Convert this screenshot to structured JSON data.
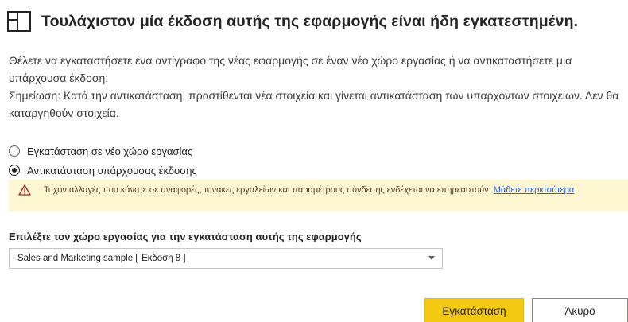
{
  "dialog": {
    "title": "Τουλάχιστον μία έκδοση αυτής της εφαρμογής είναι ήδη εγκατεστημένη.",
    "icon": "app-layout-icon",
    "description_line1": "Θέλετε να εγκαταστήσετε ένα αντίγραφο της νέας εφαρμογής σε έναν νέο χώρο εργασίας ή να αντικαταστήσετε μια υπάρχουσα έκδοση;",
    "description_line2": "Σημείωση: Κατά την αντικατάσταση, προστίθενται νέα στοιχεία και γίνεται αντικατάσταση των υπαρχόντων στοιχείων. Δεν θα καταργηθούν στοιχεία."
  },
  "options": {
    "items": [
      {
        "label": "Εγκατάσταση σε νέο χώρο εργασίας",
        "selected": false
      },
      {
        "label": "Αντικατάσταση υπάρχουσας έκδοσης",
        "selected": true
      }
    ]
  },
  "warning": {
    "icon": "warning-icon",
    "text": "Τυχόν αλλαγές που κάνατε σε αναφορές, πίνακες εργαλείων και παραμέτρους σύνδεσης ενδέχεται να επηρεαστούν. ",
    "link_text": "Μάθετε περισσότερα",
    "background": "#fff7d1"
  },
  "workspace": {
    "label": "Επιλέξτε τον χώρο εργασίας για την εγκατάσταση αυτής της εφαρμογής",
    "selected_value": "Sales and Marketing sample [ Έκδοση 8 ]"
  },
  "buttons": {
    "install_label": "Εγκατάσταση",
    "cancel_label": "Άκυρο",
    "primary_color": "#f2c811"
  }
}
